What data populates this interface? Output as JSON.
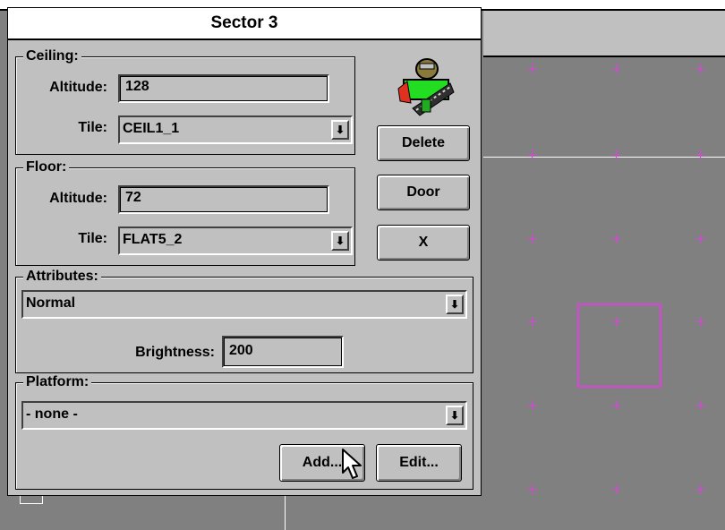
{
  "dialog": {
    "title": "Sector 3",
    "ceiling": {
      "legend": "Ceiling:",
      "altitude_label": "Altitude:",
      "altitude_value": "128",
      "tile_label": "Tile:",
      "tile_value": "CEIL1_1"
    },
    "floor": {
      "legend": "Floor:",
      "altitude_label": "Altitude:",
      "altitude_value": "72",
      "tile_label": "Tile:",
      "tile_value": "FLAT5_2"
    },
    "attributes": {
      "legend": "Attributes:",
      "selected": "Normal",
      "brightness_label": "Brightness:",
      "brightness_value": "200"
    },
    "platform": {
      "legend": "Platform:",
      "selected": "- none -",
      "add_label": "Add...",
      "edit_label": "Edit..."
    },
    "buttons": {
      "delete_label": "Delete",
      "door_label": "Door",
      "close_label": "X"
    },
    "dropdown_glyph": "⬇"
  },
  "colors": {
    "map_background": "#808080",
    "grid_marker": "#e040e0",
    "selection": "#e040e0",
    "dialog_face": "#c0c0c0"
  },
  "icons": {
    "sector": "sector-sprite-icon",
    "cursor": "arrow-cursor-icon"
  }
}
